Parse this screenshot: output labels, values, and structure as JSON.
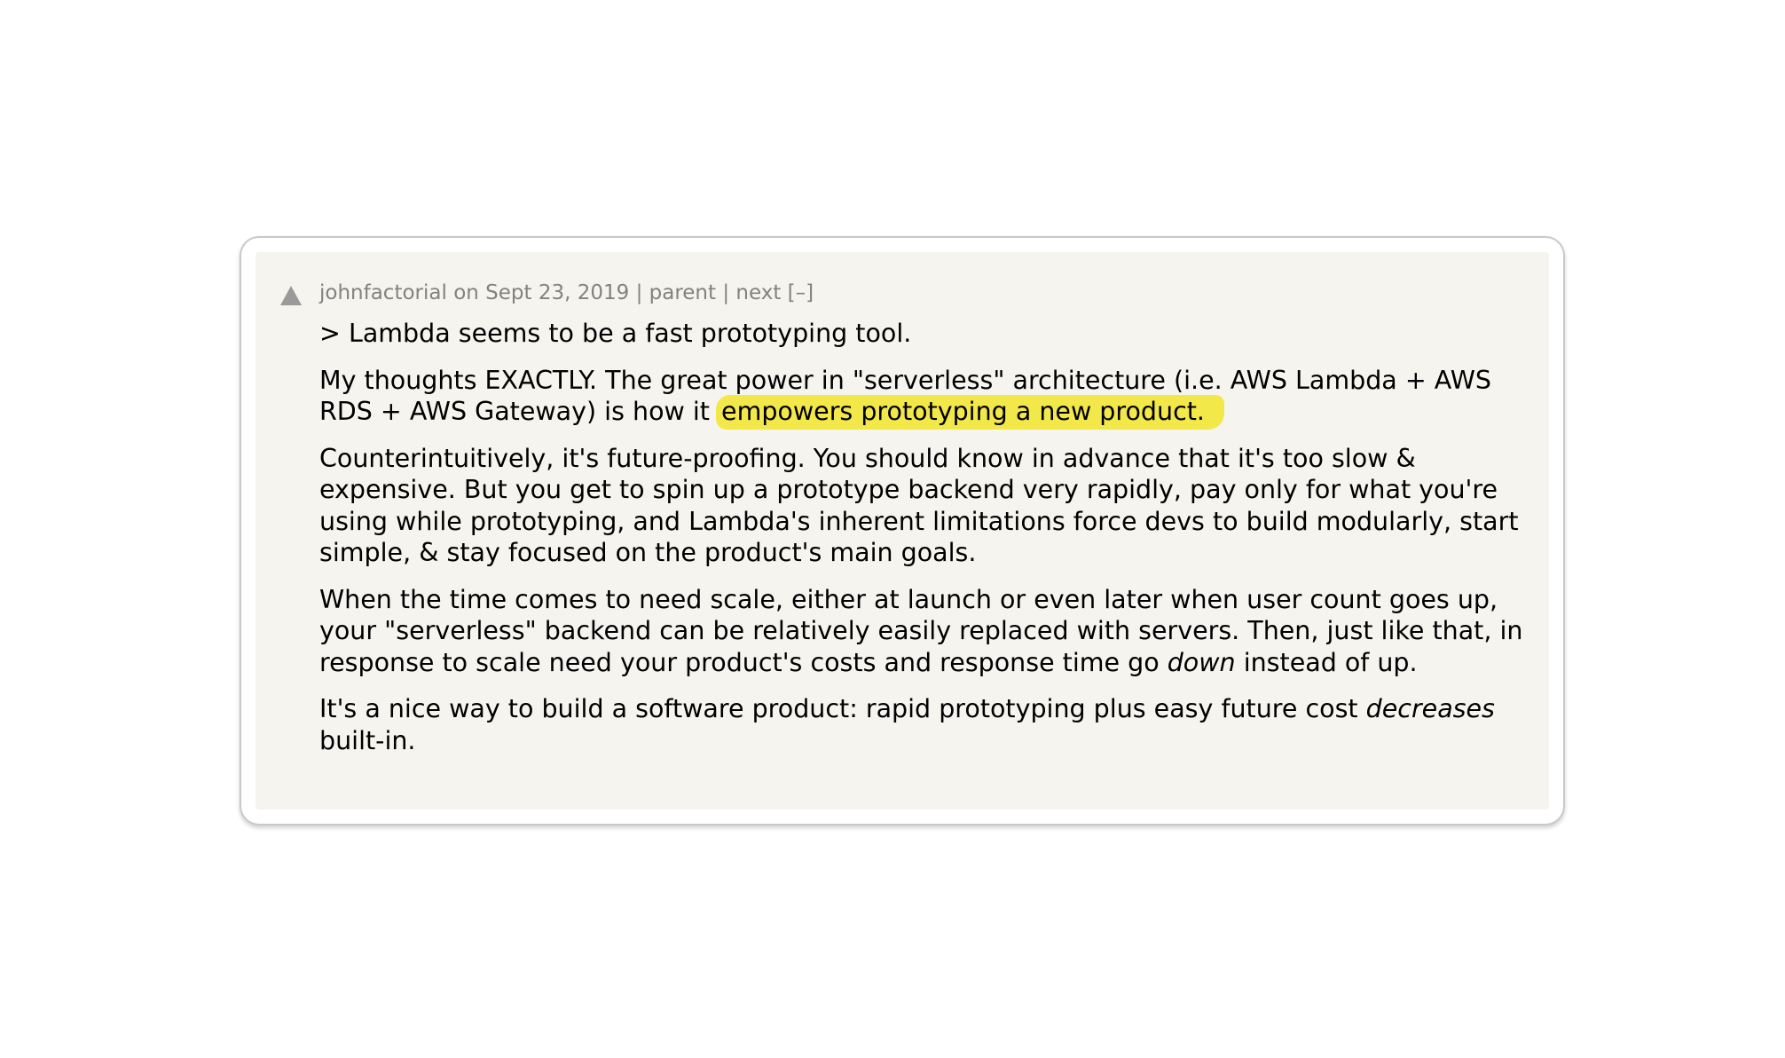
{
  "comment": {
    "vote_icon": "upvote-triangle-icon",
    "author": "johnfactorial",
    "on_word": "on",
    "date": "Sept 23, 2019",
    "sep1": "|",
    "parent_label": "parent",
    "sep2": "|",
    "next_label": "next",
    "collapse_label": "[–]",
    "quote": "> Lambda seems to be a fast prototyping tool.",
    "p1_before": "My thoughts EXACTLY. The great power in \"serverless\" architecture (i.e. AWS Lambda + AWS RDS + AWS Gateway) is how it",
    "p1_highlight": "empowers prototyping a new product.",
    "p2": "Counterintuitively, it's future-proofing. You should know in advance that it's too slow & expensive. But you get to spin up a prototype backend very rapidly, pay only for what you're using while prototyping, and Lambda's inherent limitations force devs to build modularly, start simple, & stay focused on the product's main goals.",
    "p3_before": "When the time comes to need scale, either at launch or even later when user count goes up, your \"serverless\" backend can be relatively easily replaced with servers. Then, just like that, in response to scale need your product's costs and response time go",
    "p3_em": "down",
    "p3_after": "instead of up.",
    "p4_before": "It's a nice way to build a software product: rapid prototyping plus easy future cost",
    "p4_em": "decreases",
    "p4_after": "built-in."
  },
  "colors": {
    "panel_bg": "#f5f4ee",
    "meta_text": "#828282",
    "highlight": "#f3e84a"
  }
}
